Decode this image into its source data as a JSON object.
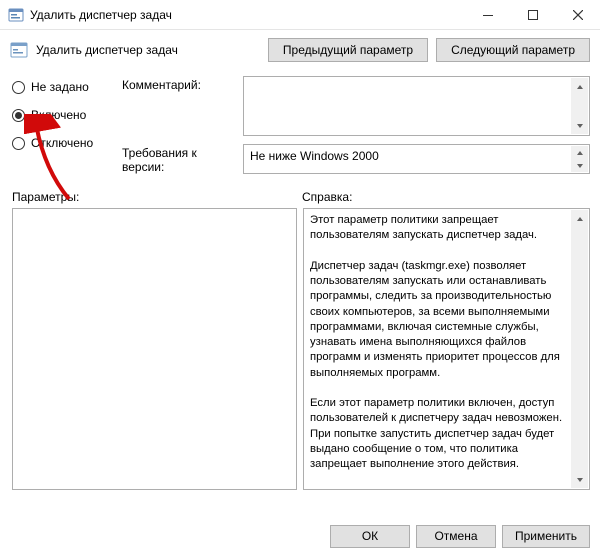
{
  "window": {
    "title": "Удалить диспетчер задач"
  },
  "header": {
    "setting_title": "Удалить диспетчер задач",
    "prev_label": "Предыдущий параметр",
    "next_label": "Следующий параметр"
  },
  "radios": {
    "not_configured": "Не задано",
    "enabled": "Включено",
    "disabled": "Отключено",
    "selected": "enabled"
  },
  "fields": {
    "comment_label": "Комментарий:",
    "comment_value": "",
    "requirements_label": "Требования к версии:",
    "requirements_value": "Не ниже Windows 2000"
  },
  "mid": {
    "options_label": "Параметры:",
    "help_label": "Справка:"
  },
  "help_text": "Этот параметр политики запрещает пользователям запускать диспетчер задач.\n\nДиспетчер задач (taskmgr.exe) позволяет пользователям запускать или останавливать программы, следить за производительностью своих компьютеров, за всеми выполняемыми программами, включая системные службы, узнавать имена выполняющихся файлов программ и изменять приоритет процессов для выполняемых программ.\n\nЕсли этот параметр политики включен, доступ пользователей к диспетчеру задач невозможен. При попытке запустить диспетчер задач будет выдано сообщение о том, что политика запрещает выполнение этого действия.\n\nЕсли этот параметр политики отключен или не задан, пользователи могут с помощью диспетчера задач запускать или останавливать программы, следить за производительностью своих компьютеров и за всеми выполняемыми программами, включая системные службы, узнавать названия исполняемых файлов программ и",
  "buttons": {
    "ok": "ОК",
    "cancel": "Отмена",
    "apply": "Применить"
  }
}
